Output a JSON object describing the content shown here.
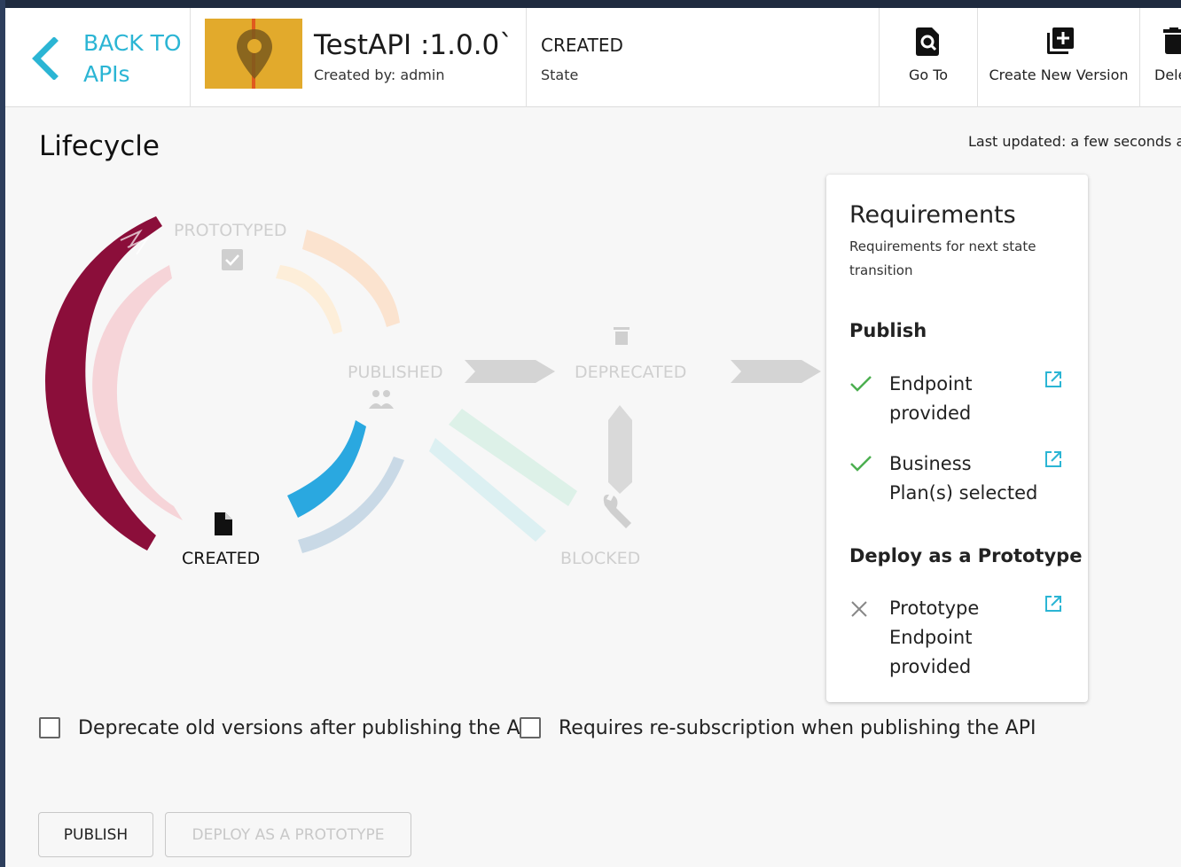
{
  "header": {
    "back_label_line1": "BACK TO",
    "back_label_line2": "APIs",
    "api_title": "TestAPI :1.0.0`",
    "created_by": "Created by: admin",
    "state_value": "CREATED",
    "state_label": "State",
    "actions": {
      "goto": "Go To",
      "create_version": "Create New Version",
      "delete": "Dele"
    }
  },
  "lifecycle": {
    "title": "Lifecycle",
    "last_updated": "Last updated: a few seconds ago",
    "states": {
      "prototyped": "PROTOTYPED",
      "published": "PUBLISHED",
      "deprecated": "DEPRECATED",
      "blocked": "BLOCKED",
      "created": "CREATED"
    },
    "current_state": "CREATED"
  },
  "requirements": {
    "title": "Requirements",
    "subtitle": "Requirements for next state transition",
    "sections": [
      {
        "title": "Publish",
        "items": [
          {
            "text": "Endpoint provided",
            "status": "met"
          },
          {
            "text": "Business Plan(s) selected",
            "status": "met"
          }
        ]
      },
      {
        "title": "Deploy as a Prototype",
        "items": [
          {
            "text": "Prototype Endpoint provided",
            "status": "unmet"
          }
        ]
      }
    ]
  },
  "options": {
    "deprecate_old": "Deprecate old versions after publishing the API",
    "require_resubscription": "Requires re-subscription when publishing the API"
  },
  "buttons": {
    "publish": "PUBLISH",
    "deploy_prototype": "DEPLOY AS A PROTOTYPE"
  },
  "colors": {
    "accent": "#2bb5d4",
    "created_arc": "#8b0e3a",
    "created_to_published": "#2aa8e0",
    "check_green": "#4caf50"
  }
}
